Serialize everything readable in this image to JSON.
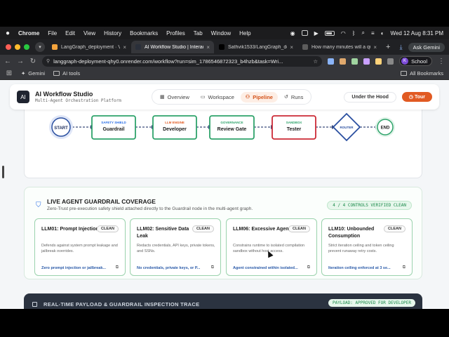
{
  "menubar": {
    "app": "Chrome",
    "items": [
      "File",
      "Edit",
      "View",
      "History",
      "Bookmarks",
      "Profiles",
      "Tab",
      "Window",
      "Help"
    ],
    "datetime": "Wed 12 Aug  8:31 PM"
  },
  "tabs": [
    {
      "title": "LangGraph_deployment · V",
      "color": "#f3a33c",
      "glyph": "",
      "active": false
    },
    {
      "title": "AI Workflow Studio | Interacti",
      "color": "#2a2f3a",
      "glyph": "",
      "active": true
    },
    {
      "title": "Sathvik1533/LangGraph_dep",
      "color": "#000000",
      "glyph": "",
      "active": false
    },
    {
      "title": "How many minutes will a qui",
      "color": "#5c5c5c",
      "glyph": "",
      "active": false
    }
  ],
  "browser": {
    "ask_gemini": "Ask Gemini",
    "url": "langgraph-deployment-qhy0.onrender.com/workflow?run=sim_1786546872323_b4hzb&task=Wri...",
    "profile_initial": "K",
    "profile_label": "School"
  },
  "bookmarks": {
    "items": [
      "Gemini",
      "AI tools"
    ],
    "all": "All Bookmarks"
  },
  "app": {
    "logo": "AI",
    "title": "AI Workflow Studio",
    "subtitle": "Multi-Agent Orchestration Platform",
    "nav": [
      {
        "label": "Overview",
        "icon": "▦"
      },
      {
        "label": "Workspace",
        "icon": "▭"
      },
      {
        "label": "Pipeline",
        "icon": "⚇"
      },
      {
        "label": "Runs",
        "icon": "↺"
      }
    ],
    "active_nav": "Pipeline",
    "under_the_hood": "Under the Hood",
    "tour": "Tour"
  },
  "pipeline": {
    "start": "START",
    "end": "END",
    "router": "ROUTER",
    "nodes": [
      {
        "tag": "SAFETY SHIELD",
        "name": "Guardrail",
        "tag_color": "#2a6ee6",
        "border": "#2fa36b"
      },
      {
        "tag": "LLM ENGINE",
        "name": "Developer",
        "tag_color": "#e15a22",
        "border": "#2fa36b"
      },
      {
        "tag": "GOVERNANCE",
        "name": "Review Gate",
        "tag_color": "#2fa36b",
        "border": "#2fa36b"
      },
      {
        "tag": "SANDBOX",
        "name": "Tester",
        "tag_color": "#2fa36b",
        "border": "#cc2a36"
      }
    ]
  },
  "guardrail": {
    "title": "LIVE AGENT GUARDRAIL COVERAGE",
    "subtitle": "Zero-Trust pre-execution safety shield attached directly to the Guardrail node in the multi-agent graph.",
    "badge": "4 / 4 CONTROLS VERIFIED CLEAN",
    "cards": [
      {
        "title": "LLM01: Prompt Injection",
        "status": "CLEAN",
        "desc": "Defends against system prompt leakage and jailbreak overrides.",
        "footer": "Zero prompt injection or jailbreak..."
      },
      {
        "title": "LLM02: Sensitive Data Leak",
        "status": "CLEAN",
        "desc": "Redacts credentials, API keys, private tokens, and SSNs.",
        "footer": "No credentials, private keys, or P..."
      },
      {
        "title": "LLM06: Excessive Agency",
        "status": "CLEAN",
        "desc": "Constrains runtime to isolated compilation sandbox without host access.",
        "footer": "Agent constrained within isolated..."
      },
      {
        "title": "LLM10: Unbounded Consumption",
        "status": "CLEAN",
        "desc": "Strict iteration ceiling and token ceiling prevent runaway retry costs.",
        "footer": "Iteration ceiling enforced at 3 se..."
      }
    ]
  },
  "trace": {
    "title": "REAL-TIME PAYLOAD & GUARDRAIL INSPECTION TRACE",
    "badge": "PAYLOAD: APPROVED FOR DEVELOPER"
  }
}
